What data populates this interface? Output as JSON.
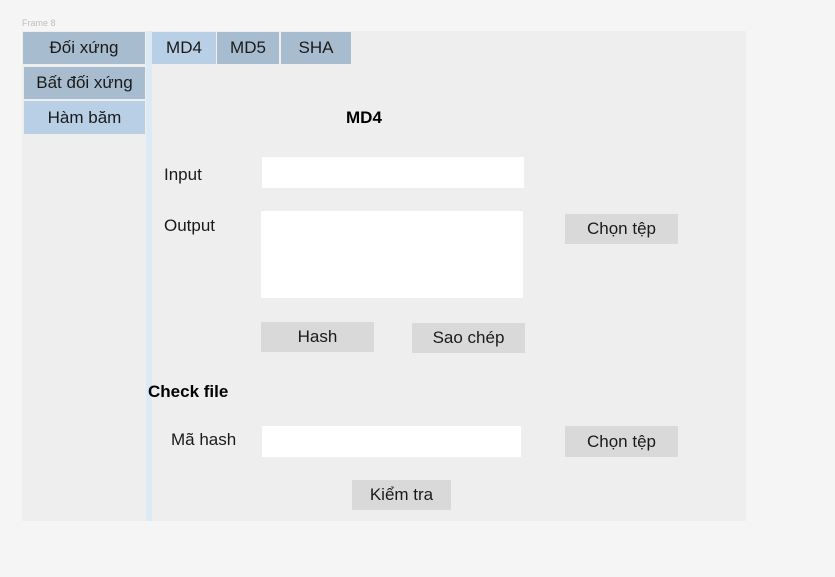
{
  "frame_label": "Frame 8",
  "sidebar": {
    "items": [
      {
        "label": "Đối xứng",
        "active": false
      },
      {
        "label": "Bất đối xứng",
        "active": false
      },
      {
        "label": "Hàm băm",
        "active": true
      }
    ]
  },
  "tabs": [
    {
      "label": "MD4",
      "active": true
    },
    {
      "label": "MD5",
      "active": false
    },
    {
      "label": "SHA",
      "active": false
    }
  ],
  "main": {
    "title": "MD4",
    "input_label": "Input",
    "input_value": "",
    "output_label": "Output",
    "output_value": "",
    "choose_file_label": "Chọn tệp",
    "hash_button": "Hash",
    "copy_button": "Sao chép"
  },
  "check": {
    "title": "Check file",
    "hash_label": "Mã hash",
    "hash_value": "",
    "choose_file_label": "Chọn tệp",
    "verify_button": "Kiểm tra"
  },
  "colors": {
    "sidebar": "#a8bccf",
    "active": "#b8cfe6",
    "button": "#d9d9d9"
  }
}
